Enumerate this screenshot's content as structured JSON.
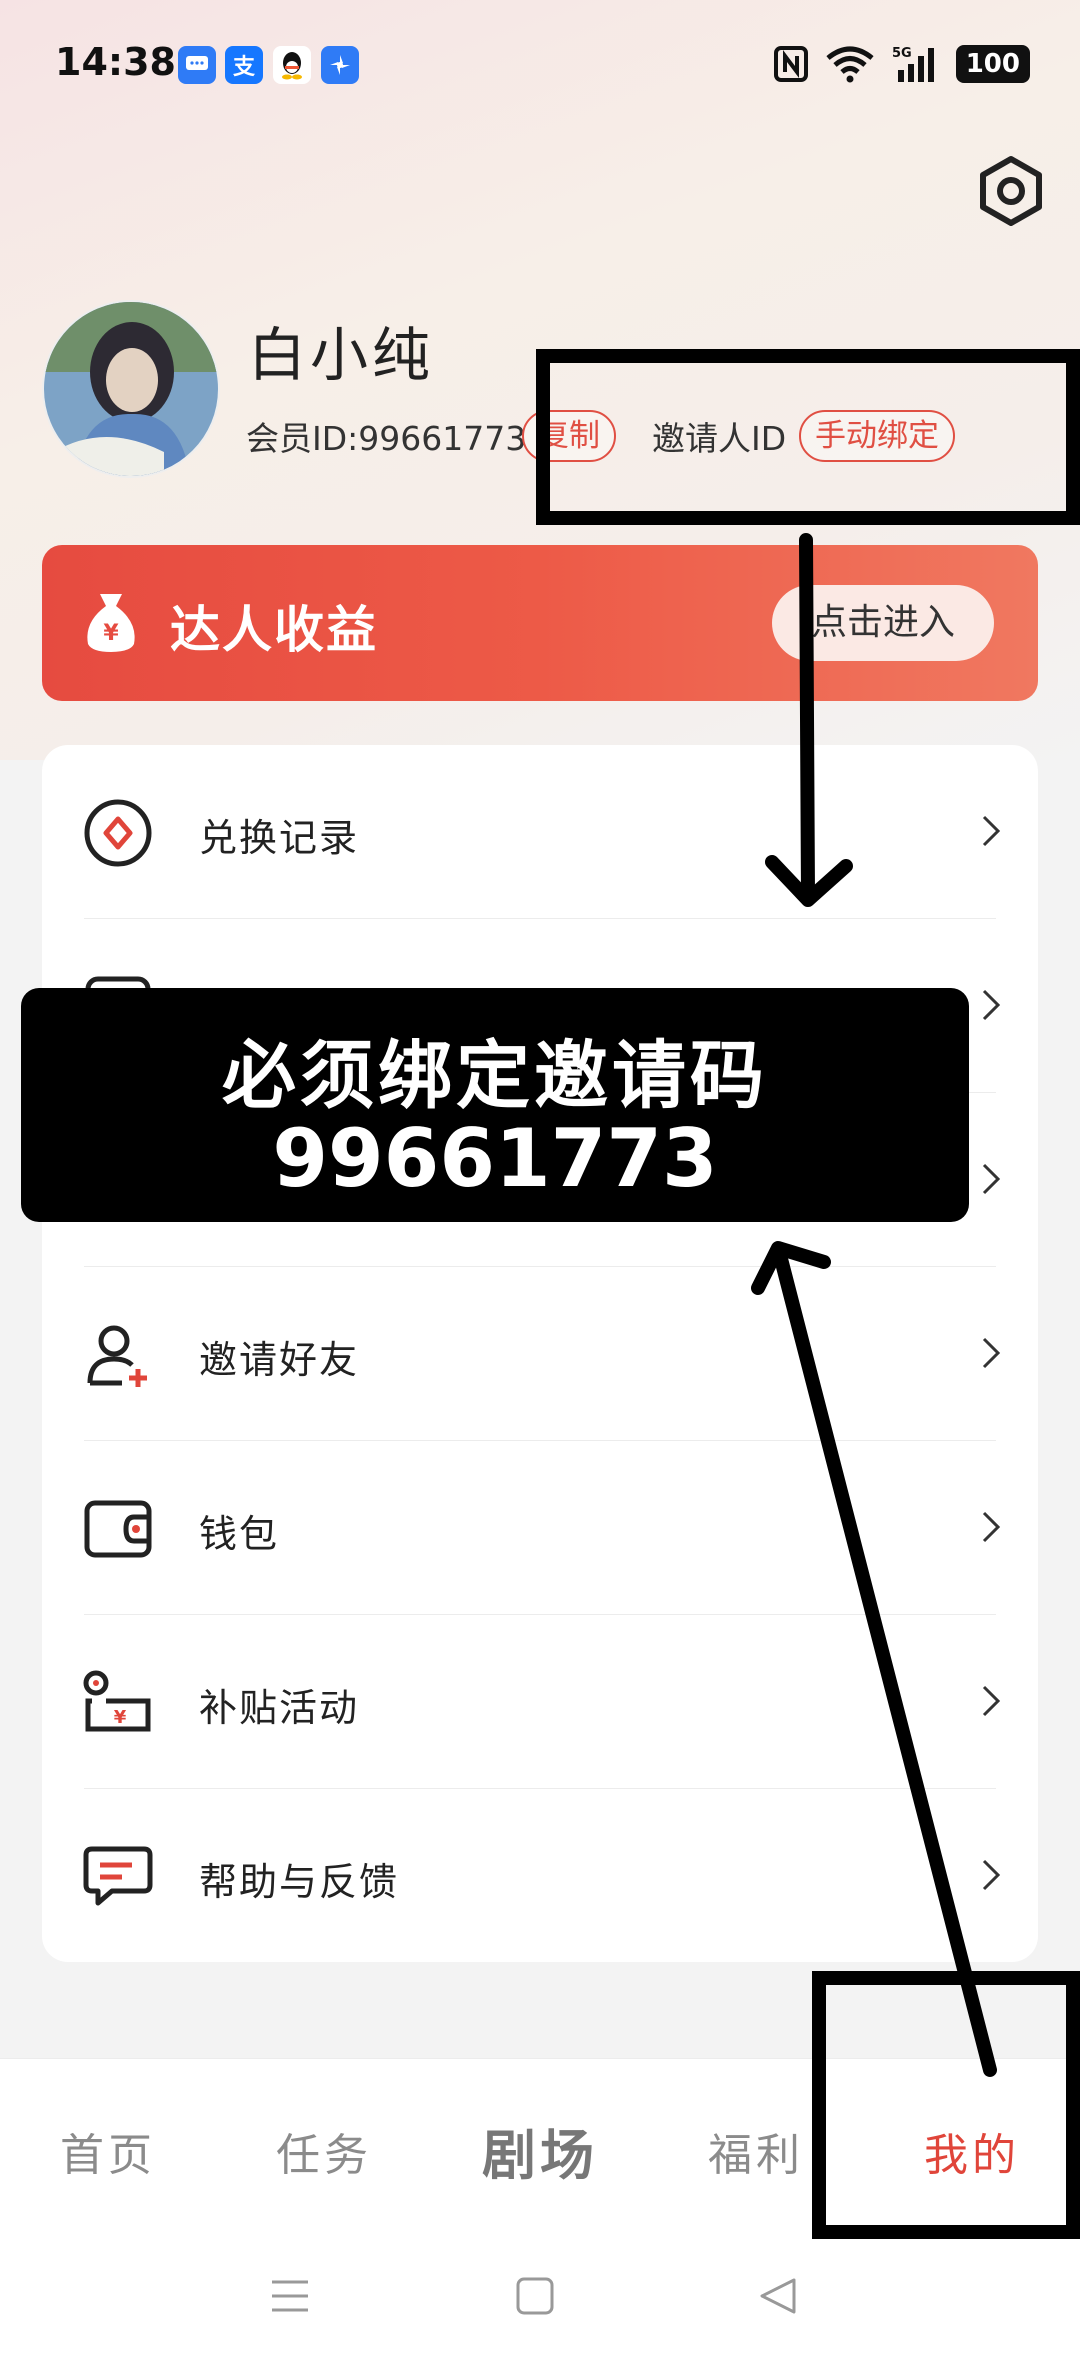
{
  "status_bar": {
    "time": "14:38",
    "app_icons": [
      "message-icon",
      "alipay-icon",
      "qq-icon",
      "pinwheel-icon"
    ],
    "battery": "100",
    "network": "5G"
  },
  "profile": {
    "name": "白小纯",
    "member_id_text": "会员ID:99661773",
    "copy_label": "复制",
    "inviter_label": "邀请人ID",
    "bind_label": "手动绑定"
  },
  "banner": {
    "title": "达人收益",
    "enter_label": "点击进入"
  },
  "menu": {
    "items": [
      {
        "label": "兑换记录",
        "icon": "exchange-icon"
      },
      {
        "label": "",
        "icon": "record-icon"
      },
      {
        "label": "",
        "icon": "history-icon"
      },
      {
        "label": "邀请好友",
        "icon": "add-user-icon"
      },
      {
        "label": "钱包",
        "icon": "wallet-icon"
      },
      {
        "label": "补贴活动",
        "icon": "subsidy-icon"
      },
      {
        "label": "帮助与反馈",
        "icon": "feedback-icon"
      }
    ]
  },
  "overlay": {
    "line1": "必须绑定邀请码",
    "line2": "99661773"
  },
  "tabs": [
    {
      "label": "首页"
    },
    {
      "label": "任务"
    },
    {
      "label": "剧场"
    },
    {
      "label": "福利"
    },
    {
      "label": "我的"
    }
  ],
  "colors": {
    "accent": "#e0453a",
    "banner_start": "#e64b40",
    "annotation": "#000000"
  }
}
